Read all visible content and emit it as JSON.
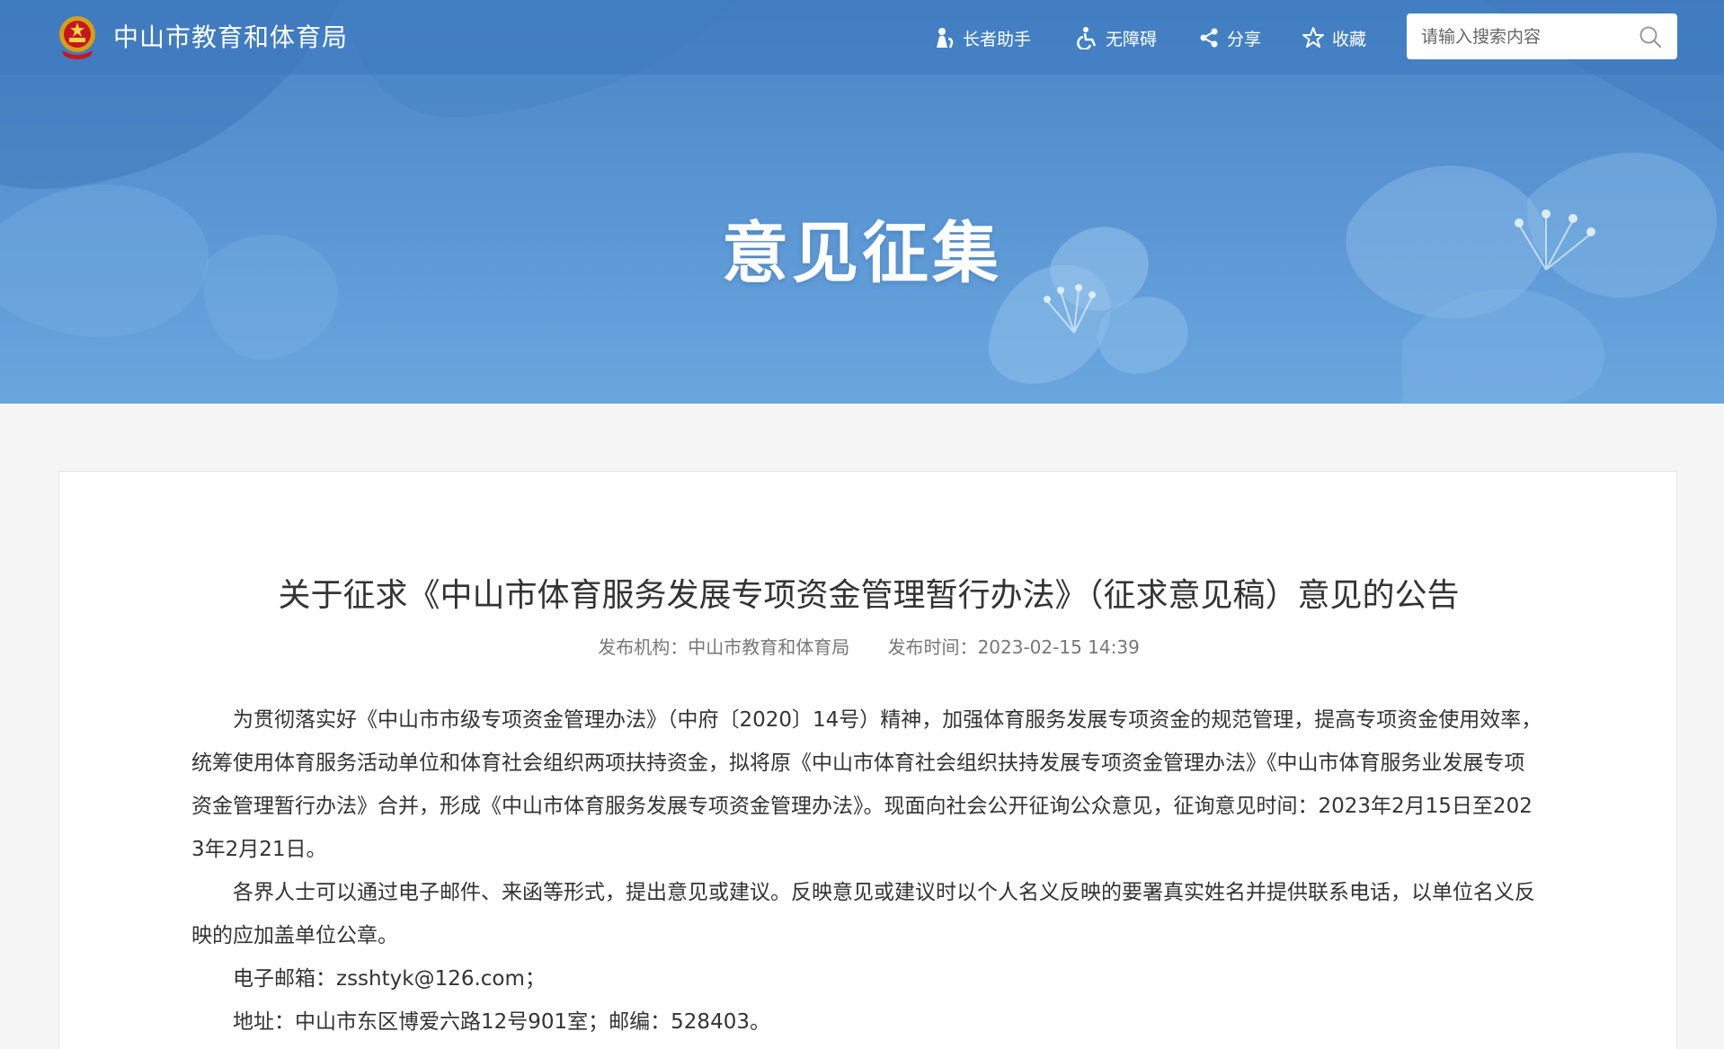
{
  "header": {
    "site_name": "中山市教育和体育局",
    "tools": [
      {
        "label": "长者助手",
        "icon": "elder-icon"
      },
      {
        "label": "无障碍",
        "icon": "accessibility-icon"
      },
      {
        "label": "分享",
        "icon": "share-icon"
      },
      {
        "label": "收藏",
        "icon": "star-icon"
      }
    ],
    "search": {
      "placeholder": "请输入搜索内容",
      "value": "",
      "icon": "search-icon"
    }
  },
  "banner": {
    "title": "意见征集"
  },
  "article": {
    "title": "关于征求《中山市体育服务发展专项资金管理暂行办法》（征求意见稿）意见的公告",
    "publisher_label": "发布机构：",
    "publisher": "中山市教育和体育局",
    "time_label": "发布时间：",
    "time": "2023-02-15 14:39",
    "paragraphs": [
      "为贯彻落实好《中山市市级专项资金管理办法》（中府〔2020〕14号）精神，加强体育服务发展专项资金的规范管理，提高专项资金使用效率，统筹使用体育服务活动单位和体育社会组织两项扶持资金，拟将原《中山市体育社会组织扶持发展专项资金管理办法》《中山市体育服务业发展专项资金管理暂行办法》合并，形成《中山市体育服务发展专项资金管理办法》。现面向社会公开征询公众意见，征询意见时间：2023年2月15日至2023年2月21日。",
      "各界人士可以通过电子邮件、来函等形式，提出意见或建议。反映意见或建议时以个人名义反映的要署真实姓名并提供联系电话，以单位名义反映的应加盖单位公章。",
      "电子邮箱：zsshtyk@126.com；",
      "地址：中山市东区博爱六路12号901室；邮编：528403。"
    ]
  },
  "colors": {
    "banner": "#5b97d4",
    "text": "#333333",
    "meta": "#777777"
  }
}
